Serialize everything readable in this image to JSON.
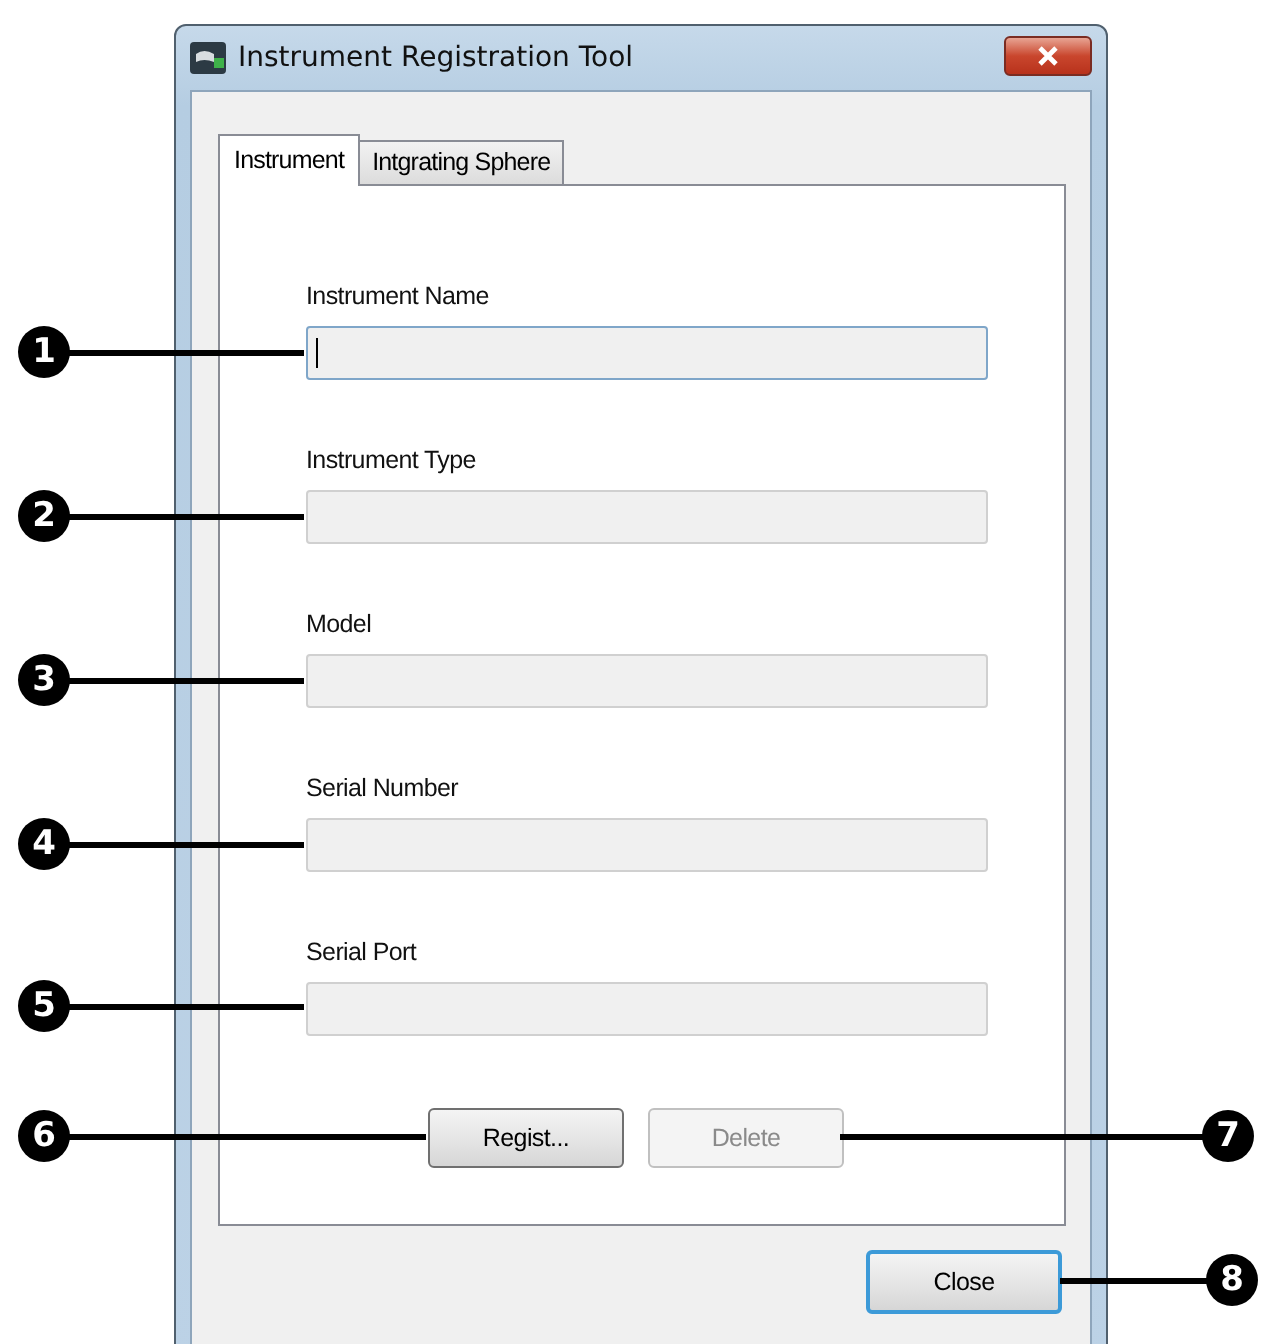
{
  "window": {
    "title": "Instrument Registration Tool"
  },
  "tabs": [
    {
      "label": "Instrument",
      "selected": true
    },
    {
      "label": "Intgrating Sphere",
      "selected": false
    }
  ],
  "fields": [
    {
      "label": "Instrument Name",
      "focused": true
    },
    {
      "label": "Instrument Type",
      "focused": false
    },
    {
      "label": "Model",
      "focused": false
    },
    {
      "label": "Serial Number",
      "focused": false
    },
    {
      "label": "Serial Port",
      "focused": false
    }
  ],
  "buttons": [
    {
      "label": "Regist...",
      "disabled": false
    },
    {
      "label": "Delete",
      "disabled": true
    }
  ],
  "close_button": {
    "label": "Close"
  },
  "callouts": [
    {
      "number": "1"
    },
    {
      "number": "2"
    },
    {
      "number": "3"
    },
    {
      "number": "4"
    },
    {
      "number": "5"
    },
    {
      "number": "6"
    },
    {
      "number": "7"
    },
    {
      "number": "8"
    }
  ]
}
